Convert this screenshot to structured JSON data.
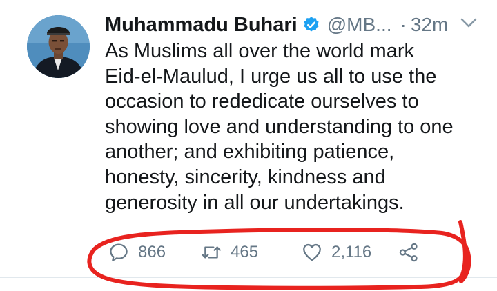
{
  "tweet": {
    "author_name": "Muhammadu Buhari",
    "handle": "@MB...",
    "separator": "·",
    "time": "32m",
    "text_lines": [
      "As Muslims all over the world mark",
      "Eid-el-Maulud, I urge us all to use the",
      "occasion to rededicate ourselves to",
      "showing love and understanding to one",
      "another; and exhibiting patience,",
      "honesty, sincerity, kindness and",
      "generosity in all our undertakings."
    ],
    "replies": "866",
    "retweets": "465",
    "likes": "2,116"
  },
  "icons": {
    "verified": "verified-badge-icon",
    "caret": "chevron-down-icon",
    "reply": "reply-icon",
    "retweet": "retweet-icon",
    "like": "heart-icon",
    "share": "share-icon"
  },
  "colors": {
    "text": "#14171a",
    "muted": "#657786",
    "verified": "#1da1f2",
    "annotation": "#e8231f"
  }
}
